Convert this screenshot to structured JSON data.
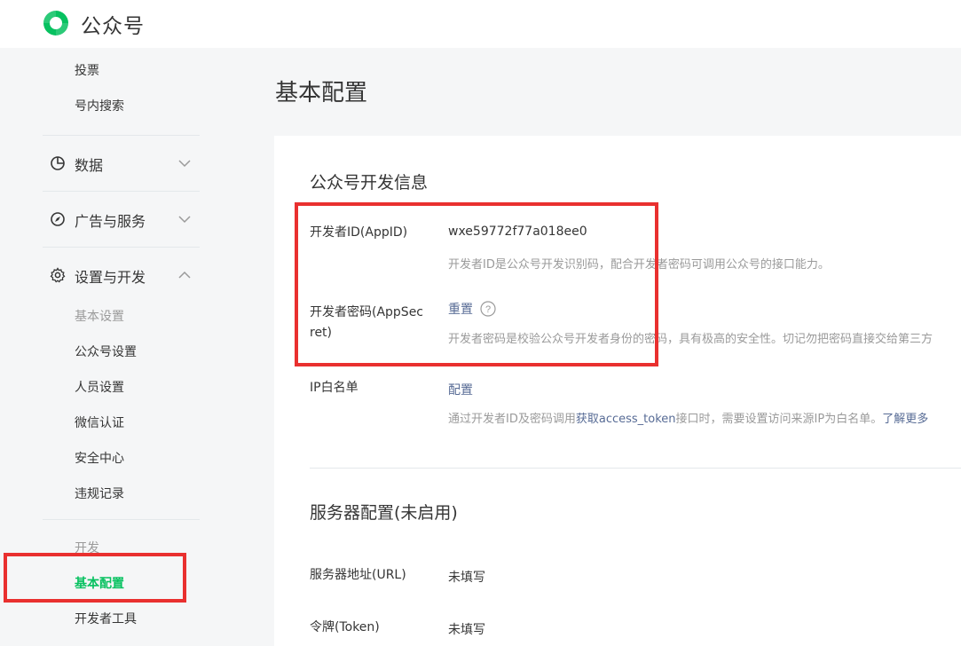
{
  "brand": {
    "name": "公众号"
  },
  "sidebar": {
    "top_items": [
      "投票",
      "号内搜索"
    ],
    "groups": [
      {
        "label": "数据",
        "icon": "chart-pie-icon",
        "expanded": false
      },
      {
        "label": "广告与服务",
        "icon": "compass-icon",
        "expanded": false
      },
      {
        "label": "设置与开发",
        "icon": "gear-icon",
        "expanded": true
      }
    ],
    "settings_items": [
      "基本设置",
      "公众号设置",
      "人员设置",
      "微信认证",
      "安全中心",
      "违规记录"
    ],
    "dev_header": "开发",
    "dev_items": [
      "基本配置",
      "开发者工具"
    ],
    "active_item": "基本配置"
  },
  "main": {
    "page_title": "基本配置",
    "dev_info": {
      "title": "公众号开发信息",
      "appid_label": "开发者ID(AppID)",
      "appid_value": "wxe59772f77a018ee0",
      "appid_desc": "开发者ID是公众号开发识别码，配合开发者密码可调用公众号的接口能力。",
      "secret_label_1": "开发者密码(AppSec",
      "secret_label_2": "ret)",
      "secret_action": "重置",
      "secret_desc": "开发者密码是校验公众号开发者身份的密码，具有极高的安全性。切记勿把密码直接交给第三方",
      "ip_label": "IP白名单",
      "ip_action": "配置",
      "ip_desc_prefix": "通过开发者ID及密码调用",
      "ip_desc_link": "获取access_token",
      "ip_desc_suffix": "接口时，需要设置访问来源IP为白名单。",
      "ip_learn_more": "了解更多"
    },
    "server_config": {
      "title": "服务器配置(未启用)",
      "url_label": "服务器地址(URL)",
      "url_value": "未填写",
      "token_label": "令牌(Token)",
      "token_value": "未填写"
    }
  },
  "colors": {
    "accent": "#07c160",
    "link": "#576b95",
    "highlight": "#e9302f"
  }
}
